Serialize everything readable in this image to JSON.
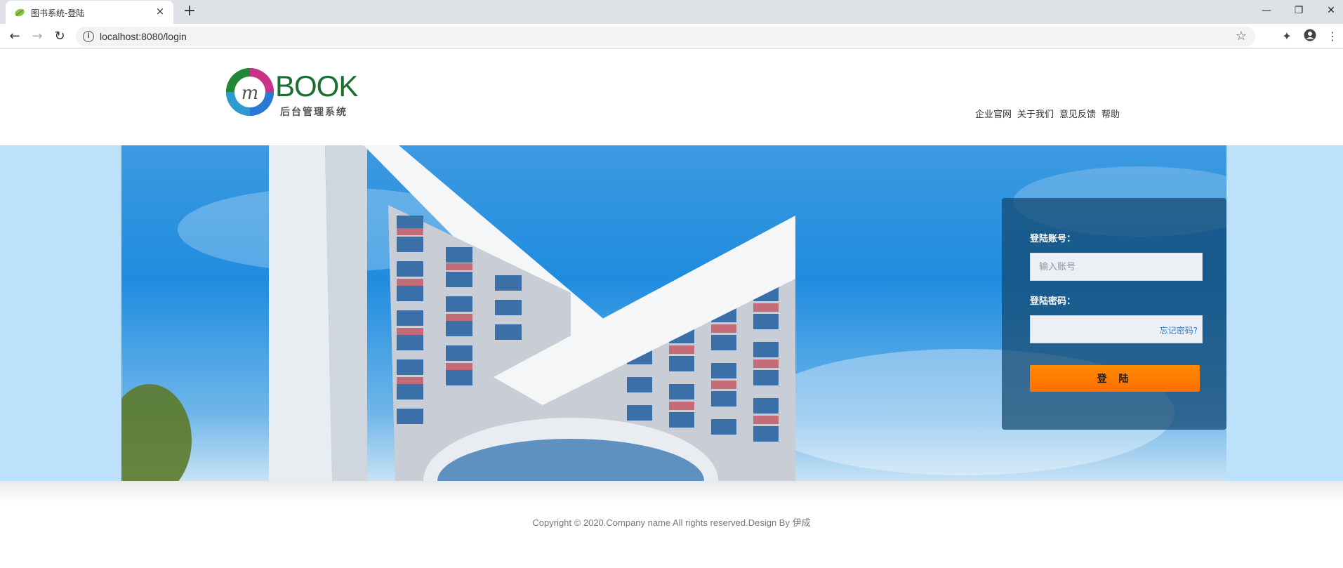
{
  "browser": {
    "tab_title": "图书系统-登陆",
    "tab_close": "×",
    "new_tab": "+",
    "url": "localhost:8080/login",
    "window": {
      "minimize": "—",
      "restore": "❐",
      "close": "✕"
    }
  },
  "header": {
    "logo_text": "BOOK",
    "logo_subtitle": "后台管理系统",
    "nav": [
      "企业官网",
      "关于我们",
      "意见反馈",
      "帮助"
    ]
  },
  "login": {
    "account_label": "登陆账号：",
    "account_placeholder": "输入账号",
    "password_label": "登陆密码：",
    "forgot_link": "忘记密码?",
    "submit_label": "登 陆"
  },
  "footer": {
    "copyright": "Copyright © 2020.Company name All rights reserved.Design By 伊成"
  },
  "colors": {
    "accent_button": "#ff7a00",
    "login_panel": "#14466e",
    "banner_side": "#bde0fb",
    "logo_green": "#1a6e2e"
  }
}
